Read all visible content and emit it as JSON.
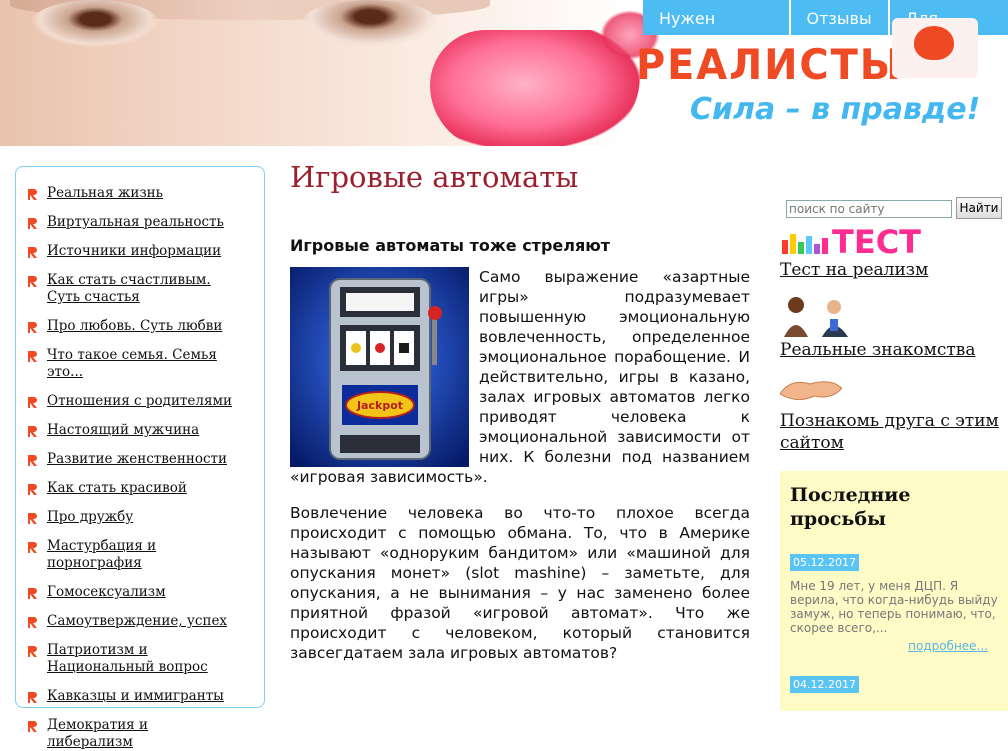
{
  "header": {
    "nav": [
      {
        "label": "Нужен совет?"
      },
      {
        "label": "Отзывы"
      },
      {
        "label": "Для писем"
      }
    ],
    "logo_title": "РЕАЛИСТЫ",
    "logo_slogan": "Сила – в правде!"
  },
  "colors": {
    "accent_blue": "#4cbcf2",
    "logo_orange": "#f04a25",
    "title_red": "#9c1f2e",
    "requests_bg": "#fffbc7"
  },
  "sidebar": {
    "items": [
      {
        "label": "Реальная жизнь"
      },
      {
        "label": "Виртуальная реальность"
      },
      {
        "label": "Источники информации"
      },
      {
        "label": "Как стать счастливым. Суть счастья"
      },
      {
        "label": "Про любовь. Суть любви"
      },
      {
        "label": "Что такое семья. Семья это..."
      },
      {
        "label": "Отношения с родителями"
      },
      {
        "label": "Настоящий мужчина"
      },
      {
        "label": "Развитие женственности"
      },
      {
        "label": "Как стать красивой"
      },
      {
        "label": "Про дружбу"
      },
      {
        "label": "Мастурбация и порнография"
      },
      {
        "label": "Гомосексуализм"
      },
      {
        "label": "Самоутверждение, успех"
      },
      {
        "label": "Патриотизм и Национальный вопрос"
      },
      {
        "label": "Кавказцы и иммигранты"
      },
      {
        "label": "Демократия и либерализм"
      }
    ]
  },
  "main": {
    "title": "Игровые автоматы",
    "subtitle": "Игровые автоматы тоже стреляют",
    "slot_jackpot_text": "Jackpot",
    "paragraph1": "Само выражение «азартные игры» подразумевает повышенную эмоциональную вовлеченность, определенное эмоциональное порабощение. И действительно, игры в казано, залах игровых автоматов легко приводят человека к эмоциональной зависимости от них. К болезни под названием «игровая зависимость».",
    "paragraph2": "Вовлечение человека во что-то плохое всегда происходит с помощью обмана. То, что в Америке называют «одноруким бандитом» или «машиной для опускания монет» (slot mashine) – заметьте, для опускания, а не вынимания – у нас заменено более приятной фразой «игровой автомат». Что же происходит с человеком, который становится завсегдатаем зала игровых автоматов?"
  },
  "search": {
    "placeholder": "поиск по сайту",
    "button_label": "Найти"
  },
  "right": {
    "test_logo_text": "ТЕСТ",
    "test_link": "Тест на реализм",
    "znak_link": "Реальные знакомства",
    "friend_link": "Познакомь друга с этим сайтом",
    "requests_title": "Последние просьбы",
    "requests": [
      {
        "date": "05.12.2017",
        "text": "Мне 19 лет, у меня ДЦП. Я верила, что когда-нибудь выйду замуж, но теперь понимаю, что, скорее всего,...",
        "more": "подробнее..."
      },
      {
        "date": "04.12.2017"
      }
    ]
  }
}
